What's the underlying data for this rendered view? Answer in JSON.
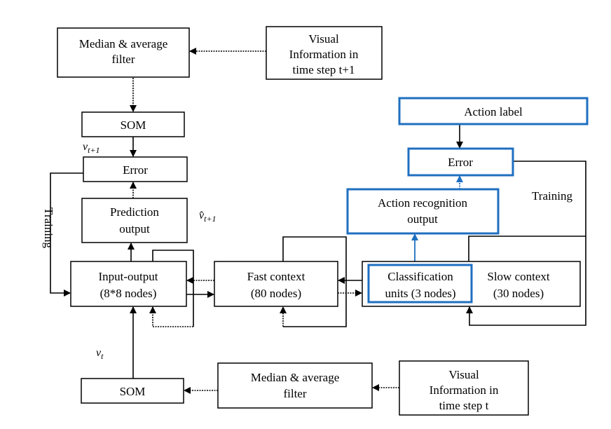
{
  "boxes": {
    "median_top": [
      "Median & average",
      "filter"
    ],
    "visual_top": [
      "Visual",
      "Information in",
      "time step t+1"
    ],
    "som_top": "SOM",
    "error_left": "Error",
    "prediction": [
      "Prediction",
      "output"
    ],
    "input_output": [
      "Input-output",
      "(8*8 nodes)"
    ],
    "fast_context": [
      "Fast context",
      "(80 nodes)"
    ],
    "classification": [
      "Classification",
      "units (3 nodes)"
    ],
    "slow_context": [
      "Slow context",
      "(30 nodes)"
    ],
    "action_label": "Action label",
    "error_right": "Error",
    "action_recognition": [
      "Action recognition",
      "output"
    ],
    "som_bottom": "SOM",
    "median_bottom": [
      "Median & average",
      "filter"
    ],
    "visual_bottom": [
      "Visual",
      "Information in",
      "time step t"
    ]
  },
  "labels": {
    "training_left": "Training",
    "training_right": "Training",
    "v_t1": "v",
    "v_t1_sub": "t+1",
    "vhat_t1": "v̂",
    "vhat_t1_sub": "t+1",
    "v_t": "v",
    "v_t_sub": "t"
  },
  "colors": {
    "highlight": "#1f6fc0"
  }
}
